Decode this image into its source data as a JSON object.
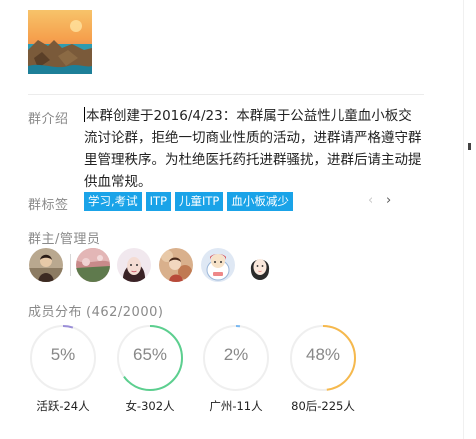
{
  "group_avatar": {
    "icon": "sea-rocks-sunset-photo"
  },
  "intro": {
    "label": "群介绍",
    "text": "本群创建于2016/4/23：本群属于公益性儿童血小板交流讨论群，拒绝一切商业性质的活动，进群请严格遵守群里管理秩序。为杜绝医托药托进群骚扰，进群后请主动提供血常规。"
  },
  "tags": {
    "label": "群标签",
    "items": [
      "学习,考试",
      "ITP",
      "儿童ITP",
      "血小板减少"
    ],
    "prev_icon": "chevron-left-icon",
    "next_icon": "chevron-right-icon",
    "color": "#1aa3e8"
  },
  "admins": {
    "label": "群主/管理员",
    "owner": {
      "icon": "owner-avatar-photo"
    },
    "items": [
      {
        "icon": "admin-avatar-1"
      },
      {
        "icon": "admin-avatar-2"
      },
      {
        "icon": "admin-avatar-3"
      },
      {
        "icon": "admin-avatar-4"
      },
      {
        "icon": "admin-avatar-5"
      }
    ]
  },
  "members": {
    "label": "成员分布",
    "count": "(462/2000)",
    "stats": [
      {
        "value": "5%",
        "fraction": 0.05,
        "caption": "活跃-24人",
        "color": "#9b8fd8"
      },
      {
        "value": "65%",
        "fraction": 0.65,
        "caption": "女-302人",
        "color": "#5ccf8f"
      },
      {
        "value": "2%",
        "fraction": 0.02,
        "caption": "广州-11人",
        "color": "#7ab8f0"
      },
      {
        "value": "48%",
        "fraction": 0.48,
        "caption": "80后-225人",
        "color": "#f6b94d"
      }
    ]
  }
}
